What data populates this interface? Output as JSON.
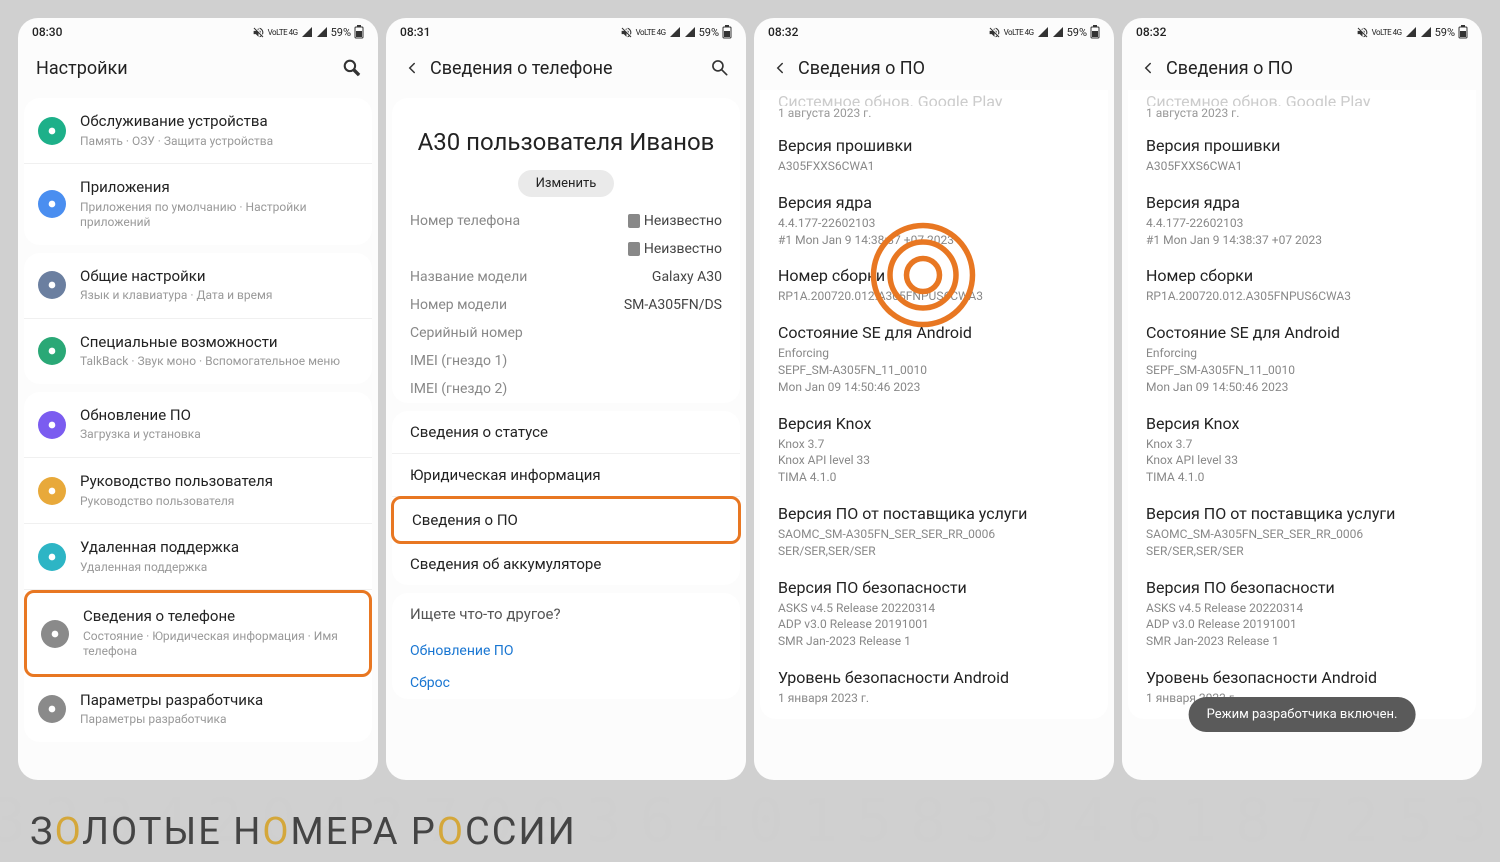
{
  "bg_numbers": "3234204270936401583946187253",
  "brand": {
    "z": "З",
    "o1": "О",
    "l": "ЛОТЫЕ Н",
    "o2": "О",
    "m": "МЕРА Р",
    "o3": "О",
    "s": "ССИИ"
  },
  "screen1": {
    "time": "08:30",
    "battery": "59%",
    "title": "Настройки",
    "group1": [
      {
        "icon_bg": "#1db089",
        "title": "Обслуживание устройства",
        "sub": "Память · ОЗУ · Защита устройства"
      },
      {
        "icon_bg": "#4a8ef0",
        "title": "Приложения",
        "sub": "Приложения по умолчанию · Настройки приложений"
      }
    ],
    "group2": [
      {
        "icon_bg": "#6b7fa0",
        "title": "Общие настройки",
        "sub": "Язык и клавиатура · Дата и время"
      },
      {
        "icon_bg": "#2aa876",
        "title": "Специальные возможности",
        "sub": "TalkBack · Звук моно · Вспомогательное меню"
      }
    ],
    "group3": [
      {
        "icon_bg": "#7b5cf0",
        "title": "Обновление ПО",
        "sub": "Загрузка и установка"
      },
      {
        "icon_bg": "#e8a93a",
        "title": "Руководство пользователя",
        "sub": "Руководство пользователя"
      },
      {
        "icon_bg": "#2db5c5",
        "title": "Удаленная поддержка",
        "sub": "Удаленная поддержка"
      },
      {
        "icon_bg": "#8a8a8a",
        "title": "Сведения о телефоне",
        "sub": "Состояние · Юридическая информация · Имя телефона",
        "highlight": true
      },
      {
        "icon_bg": "#8a8a8a",
        "title": "Параметры разработчика",
        "sub": "Параметры разработчика"
      }
    ]
  },
  "screen2": {
    "time": "08:31",
    "battery": "59%",
    "title": "Сведения о телефоне",
    "device_name": "A30 пользователя Иванов",
    "edit": "Изменить",
    "rows": [
      {
        "k": "Номер телефона",
        "v": "Неизвестно",
        "sim": true
      },
      {
        "k": "",
        "v": "Неизвестно",
        "sim": true
      },
      {
        "k": "Название модели",
        "v": "Galaxy A30"
      },
      {
        "k": "Номер модели",
        "v": "SM-A305FN/DS"
      },
      {
        "k": "Серийный номер",
        "v": ""
      },
      {
        "k": "IMEI (гнездо 1)",
        "v": ""
      },
      {
        "k": "IMEI (гнездо 2)",
        "v": ""
      }
    ],
    "links": [
      "Сведения о статусе",
      "Юридическая информация",
      "Сведения о ПО",
      "Сведения об аккумуляторе"
    ],
    "highlight_index": 2,
    "search_hint": "Ищете что-то другое?",
    "search_links": [
      "Обновление ПО",
      "Сброс"
    ]
  },
  "screen3": {
    "time": "08:32",
    "battery": "59%",
    "title": "Сведения о ПО",
    "partial_top": "Системное обнов. Google Play",
    "partial_date": "1 августа 2023 г.",
    "blocks": [
      {
        "t": "Версия прошивки",
        "d": "A305FXXS6CWA1"
      },
      {
        "t": "Версия ядра",
        "d": "4.4.177-22602103\n#1 Mon Jan 9 14:38:37 +07 2023"
      },
      {
        "t": "Номер сборки",
        "d": "RP1A.200720.012.A305FNPUS6CWA3",
        "circles": true
      },
      {
        "t": "Состояние SE для Android",
        "d": "Enforcing\nSEPF_SM-A305FN_11_0010\nMon Jan 09 14:50:46 2023"
      },
      {
        "t": "Версия Knox",
        "d": "Knox 3.7\nKnox API level 33\nTIMA 4.1.0"
      },
      {
        "t": "Версия ПО от поставщика услуги",
        "d": "SAOMC_SM-A305FN_SER_SER_RR_0006\nSER/SER,SER/SER"
      },
      {
        "t": "Версия ПО безопасности",
        "d": "ASKS v4.5 Release 20220314\nADP v3.0 Release 20191001\nSMR Jan-2023 Release 1"
      },
      {
        "t": "Уровень безопасности Android",
        "d": "1 января 2023 г."
      }
    ]
  },
  "screen4": {
    "time": "08:32",
    "battery": "59%",
    "title": "Сведения о ПО",
    "partial_top": "Системное обнов. Google Play",
    "partial_date": "1 августа 2023 г.",
    "blocks": [
      {
        "t": "Версия прошивки",
        "d": "A305FXXS6CWA1"
      },
      {
        "t": "Версия ядра",
        "d": "4.4.177-22602103\n#1 Mon Jan 9 14:38:37 +07 2023"
      },
      {
        "t": "Номер сборки",
        "d": "RP1A.200720.012.A305FNPUS6CWA3"
      },
      {
        "t": "Состояние SE для Android",
        "d": "Enforcing\nSEPF_SM-A305FN_11_0010\nMon Jan 09 14:50:46 2023"
      },
      {
        "t": "Версия Knox",
        "d": "Knox 3.7\nKnox API level 33\nTIMA 4.1.0"
      },
      {
        "t": "Версия ПО от поставщика услуги",
        "d": "SAOMC_SM-A305FN_SER_SER_RR_0006\nSER/SER,SER/SER"
      },
      {
        "t": "Версия ПО безопасности",
        "d": "ASKS v4.5 Release 20220314\nADP v3.0 Release 20191001\nSMR Jan-2023 Release 1"
      },
      {
        "t": "Уровень безопасности Android",
        "d": "1 января 2023 г."
      }
    ],
    "toast": "Режим разработчика включен."
  }
}
